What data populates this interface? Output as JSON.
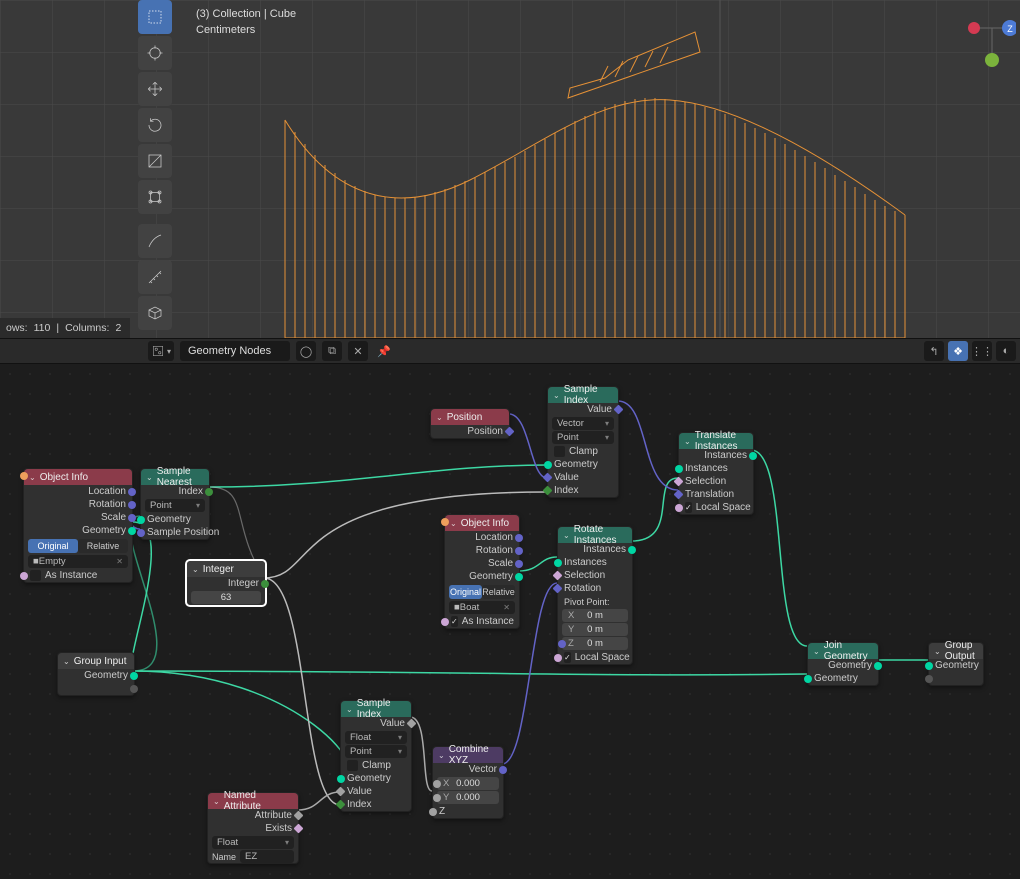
{
  "viewport": {
    "overlay_line1": "(3) Collection | Cube",
    "overlay_line2": "Centimeters"
  },
  "status": {
    "rows_label": "ows:",
    "rows": "110",
    "sep": "|",
    "cols_label": "Columns:",
    "cols": "2"
  },
  "header": {
    "editor_name": "Geometry Nodes"
  },
  "nodes": {
    "obj_info_1": {
      "title": "Object Info",
      "outs": [
        "Location",
        "Rotation",
        "Scale",
        "Geometry"
      ],
      "tab_original": "Original",
      "tab_relative": "Relative",
      "object": "Empty",
      "as_instance": "As Instance"
    },
    "sample_nearest": {
      "title": "Sample Nearest",
      "out_index": "Index",
      "domain": "Point",
      "in_geometry": "Geometry",
      "in_sample": "Sample Position"
    },
    "integer": {
      "title": "Integer",
      "out": "Integer",
      "value": "63"
    },
    "group_input": {
      "title": "Group Input",
      "out": "Geometry"
    },
    "named_attr": {
      "title": "Named Attribute",
      "out_attr": "Attribute",
      "out_exists": "Exists",
      "type": "Float",
      "name_label": "Name",
      "name_value": "EZ"
    },
    "sample_index_2": {
      "title": "Sample Index",
      "out_value": "Value",
      "type": "Float",
      "domain": "Point",
      "clamp": "Clamp",
      "in_geometry": "Geometry",
      "in_value": "Value",
      "in_index": "Index"
    },
    "position": {
      "title": "Position",
      "out": "Position"
    },
    "combine_xyz": {
      "title": "Combine XYZ",
      "out": "Vector",
      "x": "X",
      "y": "Y",
      "z": "Z",
      "xval": "0.000",
      "yval": "0.000"
    },
    "obj_info_2": {
      "title": "Object Info",
      "outs": [
        "Location",
        "Rotation",
        "Scale",
        "Geometry"
      ],
      "tab_original": "Original",
      "tab_relative": "Relative",
      "object": "Boat",
      "as_instance": "As Instance"
    },
    "sample_index_1": {
      "title": "Sample Index",
      "out_value": "Value",
      "type": "Vector",
      "domain": "Point",
      "clamp": "Clamp",
      "in_geometry": "Geometry",
      "in_value": "Value",
      "in_index": "Index"
    },
    "rotate_inst": {
      "title": "Rotate Instances",
      "out": "Instances",
      "in_instances": "Instances",
      "in_selection": "Selection",
      "in_rotation": "Rotation",
      "pivot_label": "Pivot Point:",
      "x": "X",
      "y": "Y",
      "z": "Z",
      "val": "0 m",
      "local": "Local Space"
    },
    "translate_inst": {
      "title": "Translate Instances",
      "out": "Instances",
      "in_instances": "Instances",
      "in_selection": "Selection",
      "in_translation": "Translation",
      "local": "Local Space"
    },
    "join_geo": {
      "title": "Join Geometry",
      "out": "Geometry",
      "in": "Geometry"
    },
    "group_output": {
      "title": "Group Output",
      "in": "Geometry"
    }
  }
}
